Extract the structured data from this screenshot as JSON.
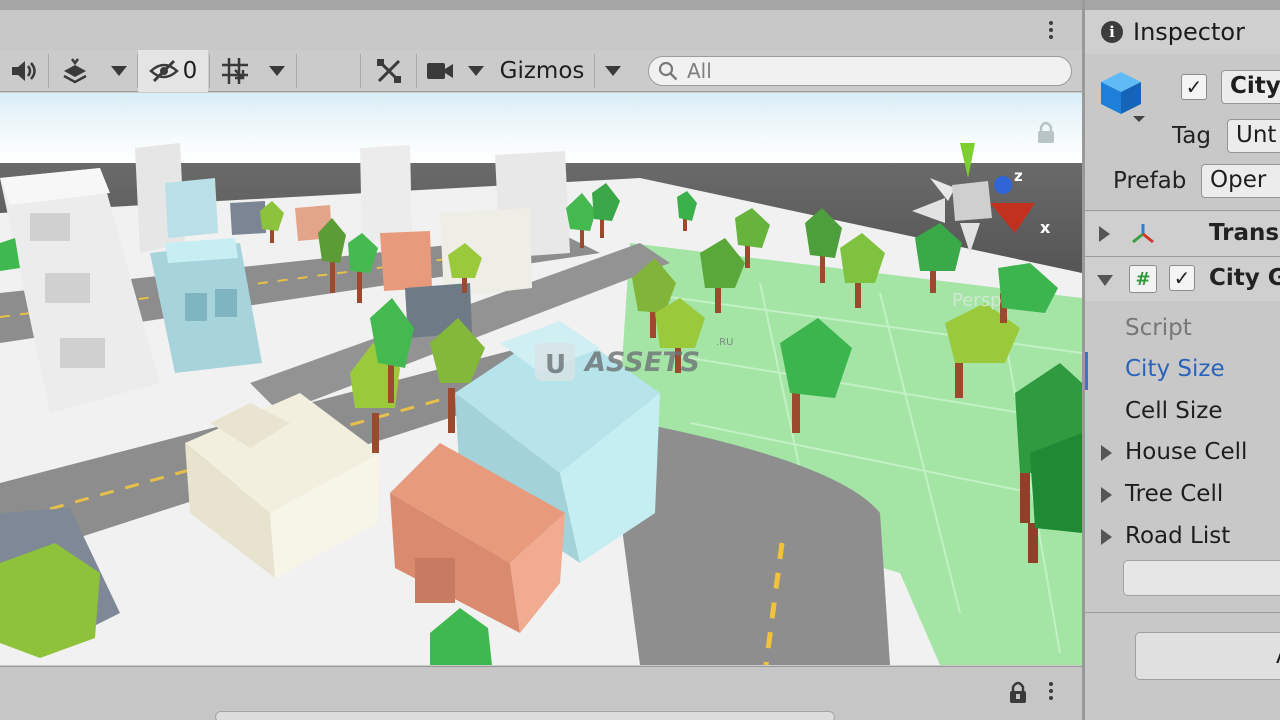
{
  "scene": {
    "toolbar": {
      "hidden_count": "0",
      "gizmos_label": "Gizmos",
      "search_placeholder": "All"
    },
    "viewport": {
      "watermark_u": "U",
      "watermark_text": "ASSETS",
      "watermark_suffix": ".RU",
      "projection_label": "Persp",
      "axis_x": "x",
      "axis_z": "z"
    }
  },
  "inspector": {
    "title": "Inspector",
    "object_name": "City",
    "tag_label": "Tag",
    "tag_value": "Unt",
    "prefab_label": "Prefab",
    "prefab_open": "Oper",
    "components": [
      {
        "name": "Trans",
        "expanded": false
      },
      {
        "name": "City G",
        "expanded": true
      }
    ],
    "properties": [
      {
        "label": "Script",
        "foldout": false,
        "selected": false,
        "muted": true
      },
      {
        "label": "City Size",
        "foldout": false,
        "selected": true,
        "muted": false
      },
      {
        "label": "Cell Size",
        "foldout": false,
        "selected": false,
        "muted": false
      },
      {
        "label": "House Cell",
        "foldout": true,
        "selected": false,
        "muted": false
      },
      {
        "label": "Tree Cell",
        "foldout": true,
        "selected": false,
        "muted": false
      },
      {
        "label": "Road List",
        "foldout": true,
        "selected": false,
        "muted": false
      }
    ],
    "bottom_button": "A"
  },
  "colors": {
    "selected_text": "#2b63b8",
    "grass": "#a4e5a6",
    "road": "#8d8d8d",
    "tree_green": "#43b94f",
    "house_salmon": "#e89a7c",
    "building_cyan": "#b6e4ea"
  }
}
